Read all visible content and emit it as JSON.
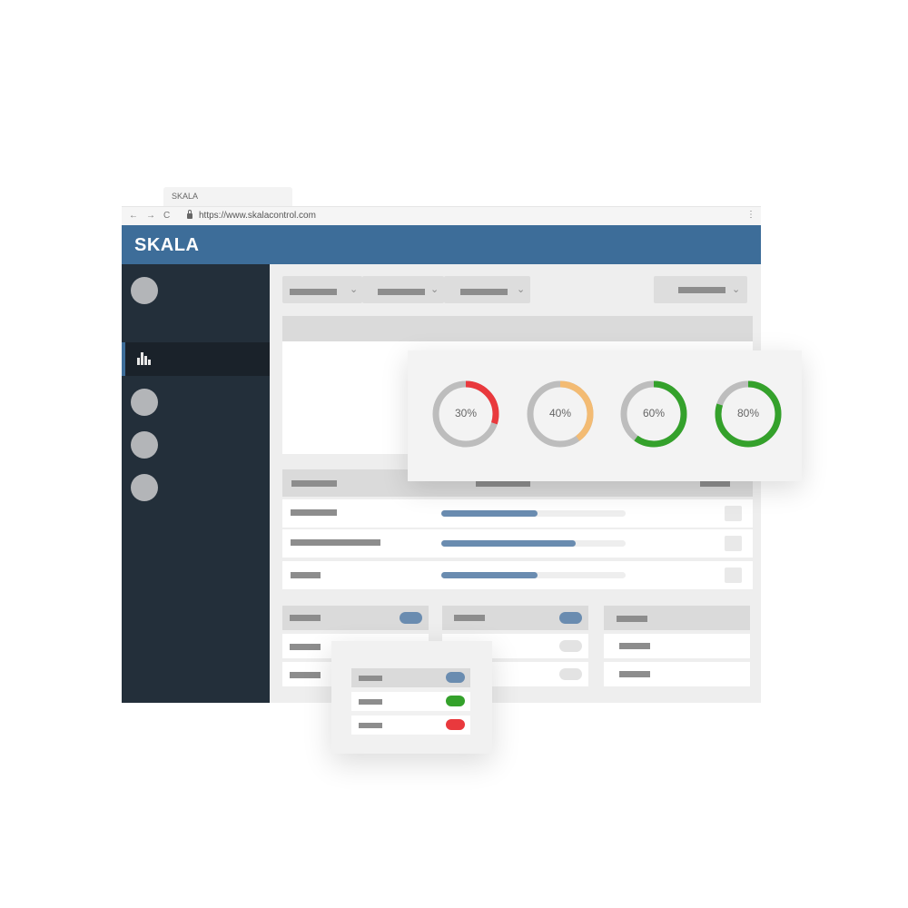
{
  "browser": {
    "tab_title": "SKALA",
    "url": "https://www.skalacontrol.com",
    "back_icon": "←",
    "forward_icon": "→",
    "reload_icon": "C",
    "menu_icon": "⋮"
  },
  "app": {
    "title": "SKALA",
    "accent_color": "#3d6d99",
    "sidebar_color": "#232f3a"
  },
  "sidebar": {
    "active_item_icon": "bar-chart-icon"
  },
  "progress_rows": [
    {
      "progress": 0.52
    },
    {
      "progress": 0.73
    },
    {
      "progress": 0.52
    }
  ],
  "donuts": [
    {
      "label": "30%",
      "value": 30,
      "color": "#e9393d"
    },
    {
      "label": "40%",
      "value": 40,
      "color": "#f3bb73"
    },
    {
      "label": "60%",
      "value": 60,
      "color": "#34a12b"
    },
    {
      "label": "80%",
      "value": 80,
      "color": "#34a12b"
    }
  ],
  "toggle_panel": {
    "toggles": [
      {
        "state": "blue",
        "color": "#6a8cb0"
      },
      {
        "state": "on",
        "color": "#34a12b"
      },
      {
        "state": "off",
        "color": "#e9393d"
      }
    ]
  }
}
